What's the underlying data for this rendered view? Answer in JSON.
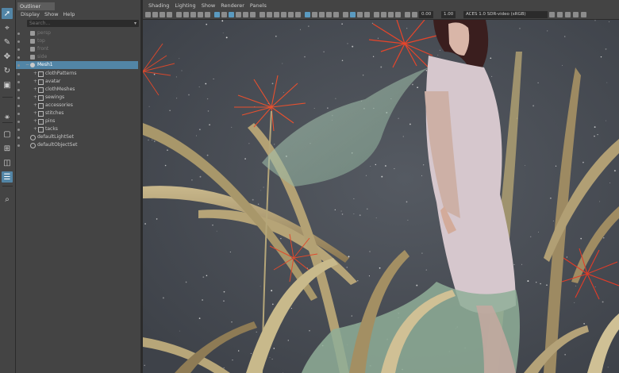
{
  "toolbox": {
    "tools": [
      "select-tool",
      "lasso-tool",
      "paint-select-tool",
      "move-tool",
      "rotate-tool",
      "scale-tool",
      "soft-mod-tool",
      "single-layout",
      "four-view-layout",
      "two-view-layout",
      "outliner-layout",
      "zoom-tool"
    ]
  },
  "outliner": {
    "title": "Outliner",
    "menu": [
      "Display",
      "Show",
      "Help"
    ],
    "search_placeholder": "Search...",
    "rows": [
      {
        "label": "persp",
        "indent": 0,
        "icon": "camera",
        "dim": true
      },
      {
        "label": "top",
        "indent": 0,
        "icon": "camera",
        "dim": true
      },
      {
        "label": "front",
        "indent": 0,
        "icon": "camera",
        "dim": true
      },
      {
        "label": "side",
        "indent": 0,
        "icon": "camera",
        "dim": true
      },
      {
        "label": "Mesh1",
        "indent": 0,
        "icon": "transform",
        "selected": true,
        "expand": "−"
      },
      {
        "label": "clothPatterns",
        "indent": 1,
        "icon": "group",
        "expand": "+"
      },
      {
        "label": "avatar",
        "indent": 1,
        "icon": "group",
        "expand": "+"
      },
      {
        "label": "clothMeshes",
        "indent": 1,
        "icon": "group",
        "expand": "+"
      },
      {
        "label": "sewings",
        "indent": 1,
        "icon": "group",
        "expand": "+"
      },
      {
        "label": "accessories",
        "indent": 1,
        "icon": "group",
        "expand": "+"
      },
      {
        "label": "stitches",
        "indent": 1,
        "icon": "group",
        "expand": "+"
      },
      {
        "label": "pins",
        "indent": 1,
        "icon": "group",
        "expand": "+"
      },
      {
        "label": "tacks",
        "indent": 1,
        "icon": "group",
        "expand": "+"
      },
      {
        "label": "defaultLightSet",
        "indent": 0,
        "icon": "set"
      },
      {
        "label": "defaultObjectSet",
        "indent": 0,
        "icon": "set"
      }
    ]
  },
  "viewport": {
    "menu": [
      "Shading",
      "Lighting",
      "Show",
      "Renderer",
      "Panels"
    ],
    "exposure_value": "0.00",
    "gamma_value": "1.00",
    "color_space": "ACES 1.0 SDR-video (sRGB)"
  },
  "colors": {
    "selection": "#5285a6",
    "panel": "#444444",
    "background_sky": "#4a4e55"
  }
}
